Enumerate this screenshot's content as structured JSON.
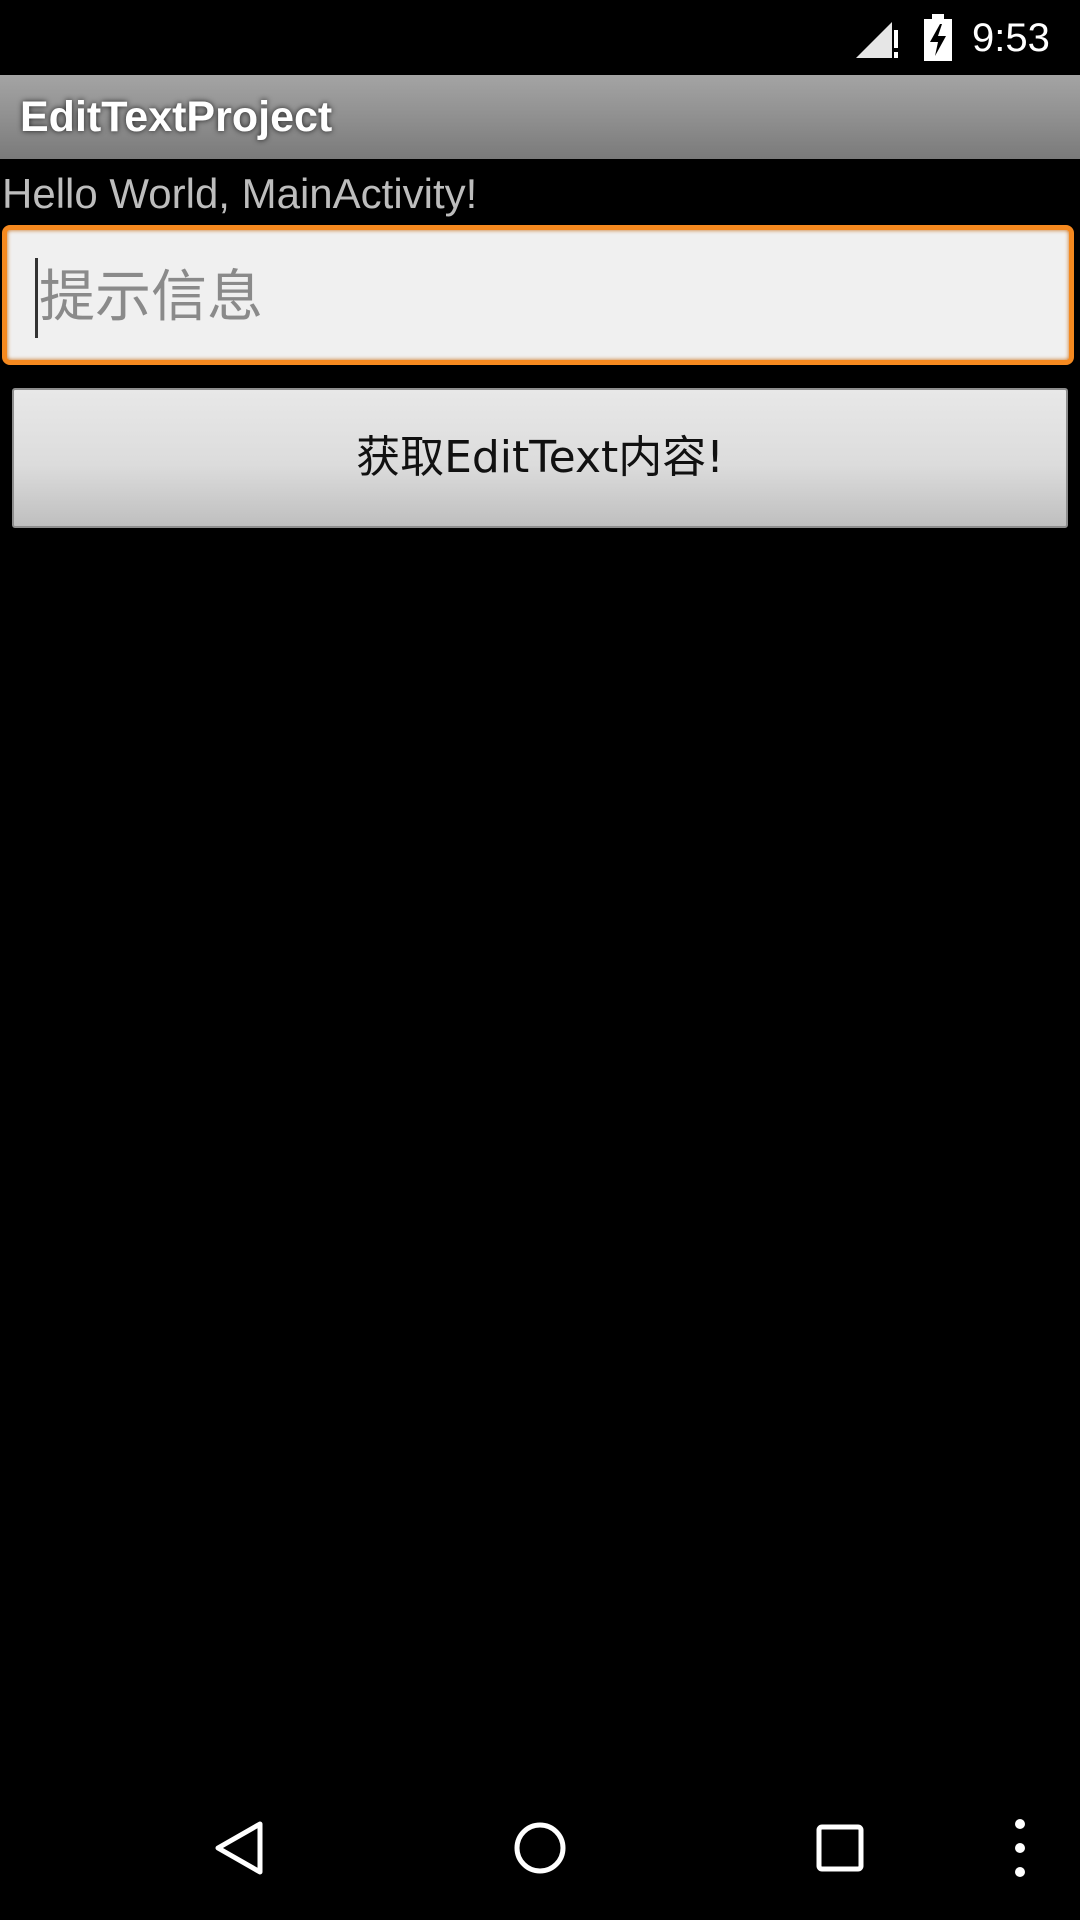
{
  "status_bar": {
    "time": "9:53",
    "icons": [
      "signal-no-data-icon",
      "battery-charging-icon"
    ]
  },
  "action_bar": {
    "title": "EditTextProject"
  },
  "content": {
    "greeting": "Hello World, MainActivity!",
    "edit_text": {
      "value": "",
      "placeholder": "提示信息"
    },
    "button_label": "获取EditText内容!"
  },
  "nav_bar": {
    "icons": [
      "back-icon",
      "home-icon",
      "recent-apps-icon",
      "overflow-menu-icon"
    ]
  },
  "colors": {
    "accent": "#f5891f",
    "background": "#000000",
    "action_bar": "#909090"
  }
}
